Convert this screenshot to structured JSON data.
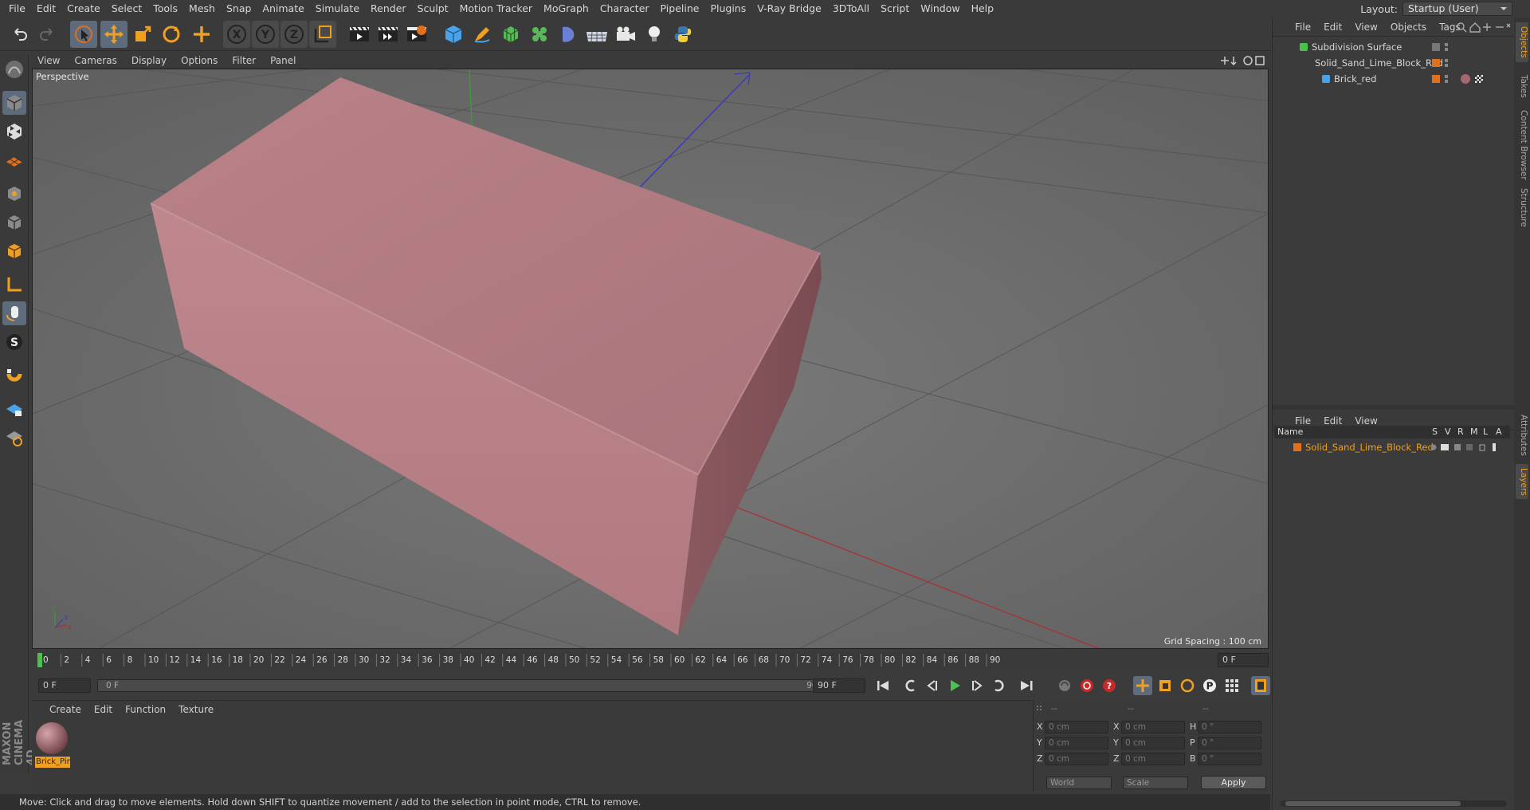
{
  "menubar": {
    "items": [
      "File",
      "Edit",
      "Create",
      "Select",
      "Tools",
      "Mesh",
      "Snap",
      "Animate",
      "Simulate",
      "Render",
      "Sculpt",
      "Motion Tracker",
      "MoGraph",
      "Character",
      "Pipeline",
      "Plugins",
      "V-Ray Bridge",
      "3DToAll",
      "Script",
      "Window",
      "Help"
    ],
    "layout_label": "Layout:",
    "layout_value": "Startup (User)"
  },
  "toolbar": {
    "icons": [
      "undo-icon",
      "redo-icon",
      "live-select-icon",
      "move-icon",
      "scale-icon",
      "rotate-icon",
      "add-object-icon",
      "x-axis-icon",
      "y-axis-icon",
      "z-axis-icon",
      "coordinate-system-icon",
      "render-view-icon",
      "render-picture-viewer-icon",
      "render-settings-icon",
      "cube-icon",
      "pen-icon",
      "subdivision-icon",
      "cloner-icon",
      "deformer-icon",
      "floor-icon",
      "camera-icon",
      "light-icon",
      "python-icon"
    ]
  },
  "left_tools": [
    "make-editable-icon",
    "model-mode-icon",
    "texture-mode-icon",
    "workplane-icon",
    "point-mode-icon",
    "edge-mode-icon",
    "polygon-mode-icon",
    "axis-mode-icon",
    "tweak-mode-icon",
    "solo-icon",
    "snap-icon",
    "workplane-lock-icon",
    "locked-workplane-icon"
  ],
  "viewport": {
    "menu": [
      "View",
      "Cameras",
      "Display",
      "Options",
      "Filter",
      "Panel"
    ],
    "label": "Perspective",
    "grid_spacing": "Grid Spacing : 100 cm",
    "colors": {
      "brick": "#b87f86",
      "background": "#6e6e6e"
    }
  },
  "timeline": {
    "ticks": [
      "0",
      "2",
      "4",
      "6",
      "8",
      "10",
      "12",
      "14",
      "16",
      "18",
      "20",
      "22",
      "24",
      "26",
      "28",
      "30",
      "32",
      "34",
      "36",
      "38",
      "40",
      "42",
      "44",
      "46",
      "48",
      "50",
      "52",
      "54",
      "56",
      "58",
      "60",
      "62",
      "64",
      "66",
      "68",
      "70",
      "72",
      "74",
      "76",
      "78",
      "80",
      "82",
      "84",
      "86",
      "88",
      "90"
    ],
    "current_frame": "0 F",
    "start_field": "0 F",
    "slider_start": "0 F",
    "slider_end": "90 F",
    "end_field": "90 F"
  },
  "material_panel": {
    "menu": [
      "Create",
      "Edit",
      "Function",
      "Texture"
    ],
    "material_name": "Brick_Pin"
  },
  "coords": {
    "headers": [
      "--",
      "--",
      "--"
    ],
    "rows": [
      {
        "a": "X",
        "av": "0 cm",
        "b": "X",
        "bv": "0 cm",
        "c": "H",
        "cv": "0 °"
      },
      {
        "a": "Y",
        "av": "0 cm",
        "b": "Y",
        "bv": "0 cm",
        "c": "P",
        "cv": "0 °"
      },
      {
        "a": "Z",
        "av": "0 cm",
        "b": "Z",
        "bv": "0 cm",
        "c": "B",
        "cv": "0 °"
      }
    ],
    "world": "World",
    "scale": "Scale",
    "apply": "Apply"
  },
  "status": "Move: Click and drag to move elements. Hold down SHIFT to quantize movement / add to the selection in point mode, CTRL to remove.",
  "object_manager": {
    "menu": [
      "File",
      "Edit",
      "View",
      "Objects",
      "Tags"
    ],
    "objects": [
      "Subdivision Surface",
      "Solid_Sand_Lime_Block_Red",
      "Brick_red"
    ]
  },
  "layer_manager": {
    "menu": [
      "File",
      "Edit",
      "View"
    ],
    "columns": [
      "Name",
      "S",
      "V",
      "R",
      "M",
      "L",
      "A"
    ],
    "layer": "Solid_Sand_Lime_Block_Red"
  },
  "side_tabs": [
    "Objects",
    "Takes",
    "Content Browser",
    "Structure",
    "Attributes",
    "Layers"
  ],
  "branding": "MAXON CINEMA 4D"
}
